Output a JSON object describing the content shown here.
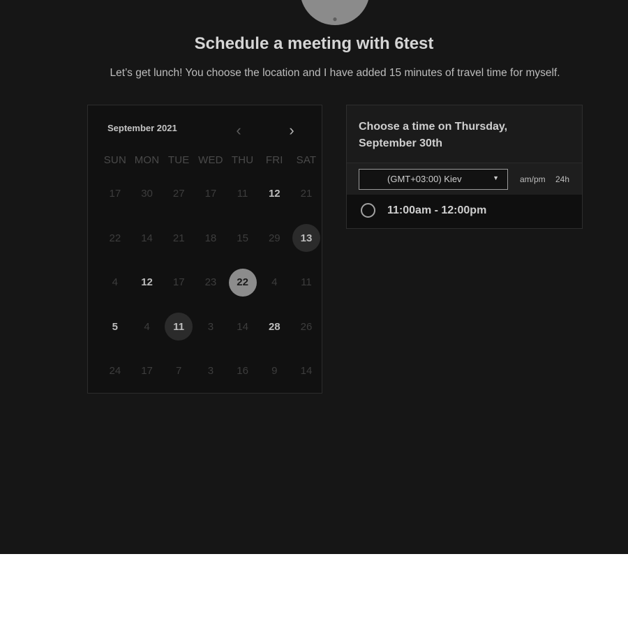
{
  "header": {
    "title": "Schedule a meeting with 6test",
    "description": "Let’s get lunch! You choose the location and I have added 15 minutes of travel time for myself."
  },
  "calendar": {
    "month": "September 2021",
    "prev_icon": "chevron-left-icon",
    "next_icon": "chevron-right-icon",
    "weekdays": [
      "SUN",
      "MON",
      "TUE",
      "WED",
      "THU",
      "FRI",
      "SAT"
    ],
    "weeks": [
      [
        "17",
        "30",
        "27",
        "17",
        "11",
        "12",
        "21"
      ],
      [
        "22",
        "14",
        "21",
        "18",
        "15",
        "29",
        "13"
      ],
      [
        "4",
        "12",
        "17",
        "23",
        "22",
        "4",
        "11"
      ],
      [
        "5",
        "4",
        "11",
        "3",
        "14",
        "28",
        "26"
      ],
      [
        "24",
        "17",
        "7",
        "3",
        "16",
        "9",
        "14"
      ]
    ],
    "selected_day": "22"
  },
  "time_panel": {
    "heading": "Choose a time on Thursday, September 30th",
    "timezone": "(GMT+03:00) Kiev",
    "format_ampm": "am/pm",
    "format_24h": "24h",
    "slots": [
      "11:00am - 12:00pm"
    ]
  },
  "colors": {
    "background": "#161616",
    "panel": "#1b1b1b",
    "selected": "#8c8c8c"
  }
}
